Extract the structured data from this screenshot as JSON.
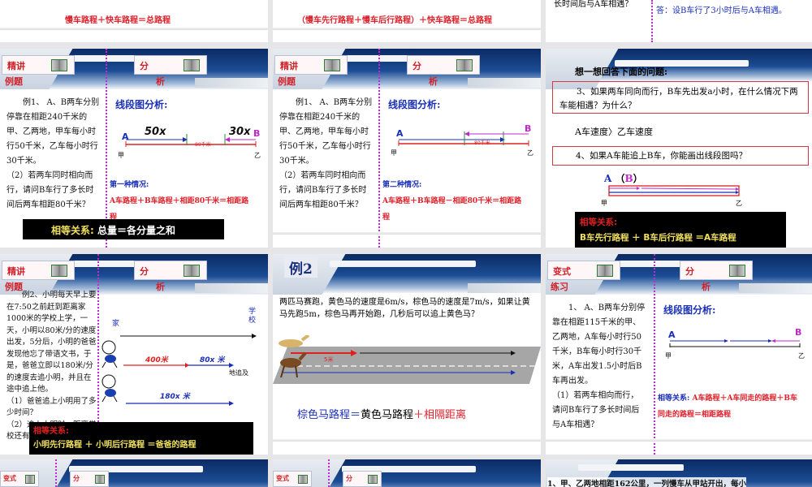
{
  "row0": {
    "s1_text": "慢车路程＋快车路程＝总路程",
    "s2_text": "（慢车先行路程＋慢车后行路程）＋快车路程＝总路程",
    "s3_left": "长时间后与A车相遇？",
    "s3_right": "答：设B车行了3小时后与A车相遇。"
  },
  "labels": {
    "jingjiang": "精讲",
    "liti": "例题",
    "fen": "分",
    "xi": "析",
    "bianshi": "变式",
    "lianxi": "练习"
  },
  "slide1": {
    "problem": [
      "例1、 A、B两车分别停靠在相距240千米的甲、乙两地，甲车每小时行50千米，乙车每小时行30千米。",
      "（2）若两车同时相向而行，请问B车行了多长时间后两车相距80千米？"
    ],
    "analysis_title": "线段图分析:",
    "a": "A",
    "b": "B",
    "a_dist": "50x",
    "b_dist": "30x",
    "gap": "80千米",
    "jia": "甲",
    "yi": "乙",
    "case": "第一种情况:",
    "equation": "A车路程＋B车路程＋相距80千米＝相距路程",
    "relation_label": "相等关系:",
    "relation": "总量＝各分量之和"
  },
  "slide2": {
    "problem": [
      "例1、 A、B两车分别停靠在相距240千米的甲、乙两地，甲车每小时行50千米，乙车每小时行30千米。",
      "（2）若两车同时相向而行，请问B车行了多长时间后两车相距80千米？"
    ],
    "analysis_title": "线段图分析:",
    "a": "A",
    "b": "B",
    "gap": "80千米",
    "jia": "甲",
    "yi": "乙",
    "case": "第二种情况:",
    "equation": "A车路程＋B车路程－相距80千米＝相距路程"
  },
  "slide3": {
    "title": "想一想回答下面的问题:",
    "q3": "3、如果两车同向而行，B车先出发a小时，在什么情况下两车能相遇？为什么？",
    "answer": "A车速度〉乙车速度",
    "q4": "4、如果A车能追上B车，你能画出线段图吗？",
    "a": "A",
    "b_paren_open": "（",
    "b": "B",
    "b_paren_close": "）",
    "jia": "甲",
    "yi": "乙",
    "relation_label": "相等关系:",
    "relation": "B车先行路程 ＋ B车后行路程 ＝A车路程"
  },
  "slide4": {
    "problem": [
      "例2、小明每天早上要在7:50之前赶到距离家1000米的学校上学，一天，小明以80米/分的速度出发，5分后，小明的爸爸发现他忘了带语文书，于是，爸爸立即以180米/分的速度去追小明，并且在途中追上他。",
      "（1）爸爸追上小明用了多少时间？",
      "（2）追上小明时，距离学校还有多远？"
    ],
    "home": "家",
    "school": "学校",
    "d1": "400米",
    "d2": "80x 米",
    "d3": "180x 米",
    "catch": "地追及",
    "relation_label": "相等关系:",
    "relation": "小明先行路程 ＋ 小明后行路程 ＝爸爸的路程"
  },
  "slide5": {
    "title": "例2",
    "problem": "两匹马赛跑，黄色马的速度是6m/s，棕色马的速度是7m/s，如果让黄马先跑5m，棕色马再开始跑，几秒后可以追上黄色马？",
    "gap": "5米",
    "eq_part1": "棕色马路程＝",
    "eq_part2": "黄色马路程",
    "eq_part3": "＋相隔距离"
  },
  "slide6": {
    "problem": [
      "1、 A、B两车分别停靠在相距115千米的甲、乙两地，A车每小时行50千米，B车每小时行30千米，A车出发1.5小时后B车再出发。",
      "（1）若两车相向而行，请问B车行了多长时间后与A车相遇？"
    ],
    "analysis_title": "线段图分析:",
    "a": "A",
    "b": "B",
    "jia": "甲",
    "yi": "乙",
    "relation_label": "相等关系:",
    "relation": "A车路程＋A车同走的路程＋B车同走的路程＝相距路程"
  },
  "row3": {
    "s3_text": "1、甲、乙两地相距162公里，一列慢车从甲站开出，每小"
  }
}
